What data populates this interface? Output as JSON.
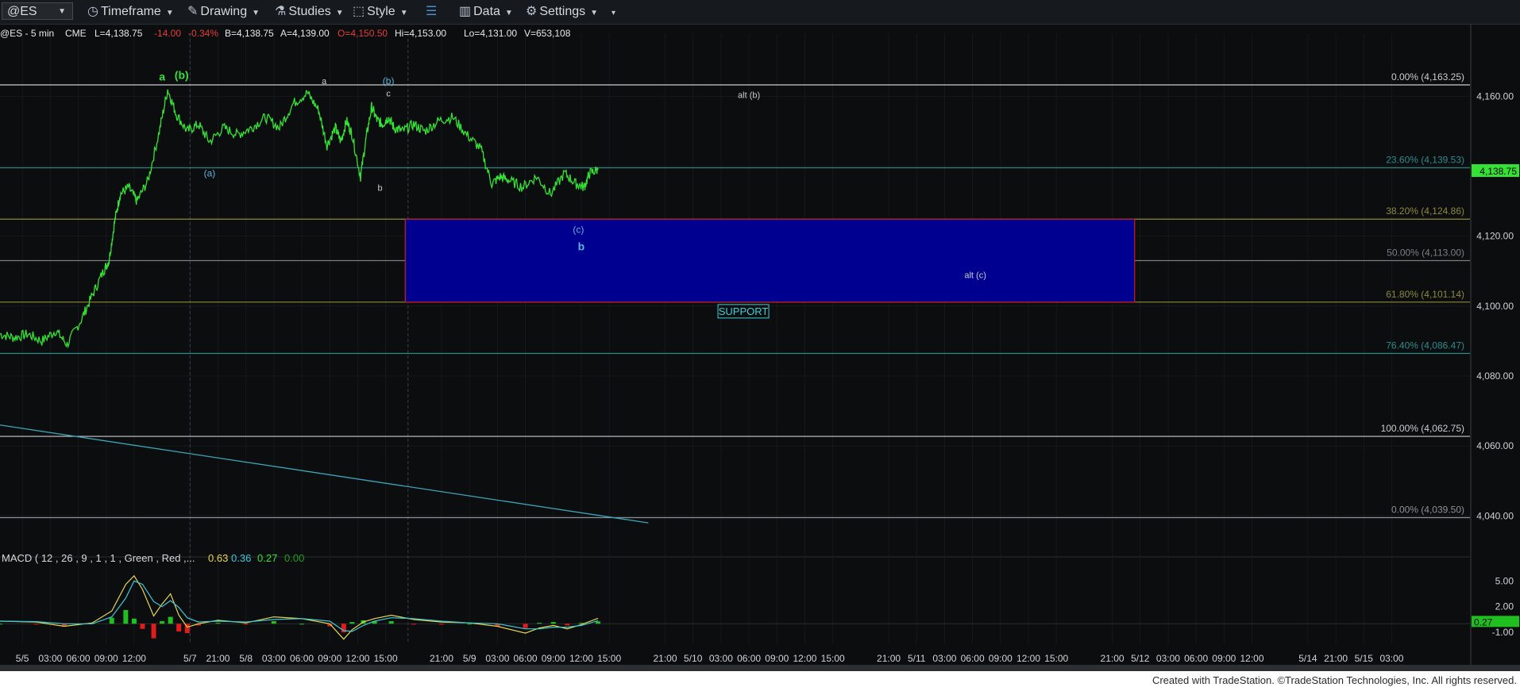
{
  "toolbar": {
    "symbol": "@ES",
    "timeframe": "Timeframe",
    "drawing": "Drawing",
    "studies": "Studies",
    "style": "Style",
    "data": "Data",
    "settings": "Settings"
  },
  "colors": {
    "background": "#0b0d0f",
    "price": "#33e233",
    "support_box": "#000090",
    "support_border": "#c81e1e",
    "axis_text": "#cfd3d8",
    "trendline": "#3aa6b9"
  },
  "chart_data": {
    "type": "line",
    "symbol_line": {
      "symbol": "@ES - 5 min",
      "exchange": "CME",
      "last": "L=4,138.75",
      "change": "-14.00",
      "change_pct": "-0.34%",
      "bid": "B=4,138.75",
      "ask": "A=4,139.00",
      "open": "O=4,150.50",
      "high": "Hi=4,153.00",
      "low": "Lo=4,131.00",
      "volume": "V=653,108"
    },
    "price_axis": {
      "ylim": [
        4031,
        4178
      ],
      "ticks": [
        4160,
        4140,
        4120,
        4100,
        4080,
        4060,
        4040
      ],
      "tick_labels": [
        "4,160.00",
        "4,120.00",
        "4,100.00",
        "4,080.00",
        "4,060.00",
        "4,040.00"
      ],
      "tick_values": [
        4160,
        4120,
        4100,
        4080,
        4060,
        4040
      ],
      "last_price_label": "4,138.75",
      "last_price": 4138.75
    },
    "time_axis": {
      "labels": [
        "5/5",
        "03:00",
        "06:00",
        "09:00",
        "12:00",
        "5/7",
        "21:00",
        "5/8",
        "03:00",
        "06:00",
        "09:00",
        "12:00",
        "15:00",
        "21:00",
        "5/9",
        "03:00",
        "06:00",
        "09:00",
        "12:00",
        "15:00",
        "21:00",
        "5/10",
        "03:00",
        "06:00",
        "09:00",
        "12:00",
        "15:00",
        "21:00",
        "5/11",
        "03:00",
        "06:00",
        "09:00",
        "12:00",
        "15:00",
        "21:00",
        "5/12",
        "03:00",
        "06:00",
        "09:00",
        "12:00",
        "5/14",
        "21:00",
        "5/15",
        "03:00"
      ],
      "positions": [
        0,
        1,
        2,
        3,
        4,
        6,
        7,
        8,
        9,
        10,
        11,
        12,
        13,
        15,
        16,
        17,
        18,
        19,
        20,
        21,
        23,
        24,
        25,
        26,
        27,
        28,
        29,
        31,
        32,
        33,
        34,
        35,
        36,
        37,
        39,
        40,
        41,
        42,
        43,
        44,
        46,
        47,
        48,
        49
      ],
      "xlim": [
        -0.8,
        51.8
      ]
    },
    "price_series": {
      "name": "@ES",
      "x": [
        -0.8,
        -0.3,
        0.2,
        0.7,
        1.2,
        1.6,
        2.1,
        2.5,
        2.9,
        3.1,
        3.3,
        3.5,
        3.8,
        4.1,
        4.5,
        4.9,
        5.2,
        5.5,
        5.9,
        6.3,
        6.7,
        7.2,
        7.7,
        8.2,
        8.7,
        9.2,
        9.7,
        10.2,
        10.6,
        10.9,
        11.2,
        11.4,
        11.6,
        11.8,
        12.1,
        12.3,
        12.5,
        12.7,
        12.9,
        13.1,
        13.3,
        13.6,
        14.0,
        14.4,
        14.9,
        15.4,
        15.9,
        16.4,
        16.8,
        17.1,
        17.4,
        17.9,
        18.4,
        18.9,
        19.4,
        19.8,
        20.1,
        20.3,
        20.6
      ],
      "y": [
        4092,
        4091,
        4092,
        4090,
        4093,
        4089,
        4096,
        4103,
        4110,
        4113,
        4124,
        4132,
        4134,
        4130,
        4136,
        4150,
        4162,
        4155,
        4150,
        4152,
        4147,
        4151,
        4149,
        4151,
        4154,
        4151,
        4158,
        4161,
        4156,
        4146,
        4151,
        4147,
        4153,
        4149,
        4137,
        4148,
        4157,
        4153,
        4152,
        4154,
        4151,
        4150,
        4152,
        4150,
        4153,
        4154,
        4149,
        4145,
        4135,
        4137,
        4136,
        4134,
        4137,
        4132,
        4138,
        4135,
        4134,
        4138,
        4139
      ]
    },
    "fib_levels": [
      {
        "label": "0.00% (4,163.25)",
        "value": 4163.25,
        "color": "#c9ccd1"
      },
      {
        "label": "23.60% (4,139.53)",
        "value": 4139.53,
        "color": "#2a8c8c"
      },
      {
        "label": "38.20% (4,124.86)",
        "value": 4124.86,
        "color": "#8f8a3a"
      },
      {
        "label": "50.00% (4,113.00)",
        "value": 4113.0,
        "color": "#7a7e84"
      },
      {
        "label": "61.80% (4,101.14)",
        "value": 4101.14,
        "color": "#8f8a3a"
      },
      {
        "label": "76.40% (4,086.47)",
        "value": 4086.47,
        "color": "#2a8c8c"
      },
      {
        "label": "100.00% (4,062.75)",
        "value": 4062.75,
        "color": "#c9ccd1"
      },
      {
        "label": "0.00% (4,039.50)",
        "value": 4039.5,
        "color": "#8d9096"
      }
    ],
    "support_zone": {
      "x_start": 13.7,
      "x_end": 39.8,
      "y_top": 4124.86,
      "y_bottom": 4101.14
    },
    "support_label": "SUPPORT",
    "trendline": {
      "x": [
        -0.8,
        22.4
      ],
      "y": [
        4066,
        4038
      ]
    },
    "wave_labels": [
      {
        "text": "a",
        "x": 5.0,
        "y": 4164.5,
        "color": "#33e233",
        "size": 14
      },
      {
        "text": "(b)",
        "x": 5.7,
        "y": 4165.0,
        "color": "#33e233",
        "size": 14
      },
      {
        "text": "(a)",
        "x": 6.7,
        "y": 4137.0,
        "color": "#5ab4d8",
        "size": 12
      },
      {
        "text": "a",
        "x": 10.8,
        "y": 4163.5,
        "color": "#c9ccd1",
        "size": 11
      },
      {
        "text": "b",
        "x": 12.8,
        "y": 4133.0,
        "color": "#c9ccd1",
        "size": 11
      },
      {
        "text": "(b)",
        "x": 13.1,
        "y": 4163.5,
        "color": "#5ab4d8",
        "size": 12
      },
      {
        "text": "c",
        "x": 13.1,
        "y": 4160.0,
        "color": "#c9ccd1",
        "size": 11
      },
      {
        "text": "alt (b)",
        "x": 26.0,
        "y": 4159.5,
        "color": "#c9ccd1",
        "size": 11
      },
      {
        "text": "(c)",
        "x": 19.9,
        "y": 4121.0,
        "color": "#5ab4d8",
        "size": 12
      },
      {
        "text": "b",
        "x": 20.0,
        "y": 4116.0,
        "color": "#5ab4d8",
        "size": 14
      },
      {
        "text": "alt (c)",
        "x": 34.1,
        "y": 4108.0,
        "color": "#c9ccd1",
        "size": 11
      }
    ],
    "session_dividers_x": [
      6.0,
      13.8
    ],
    "macd": {
      "title": "MACD ( 12 , 26 , 9 , 1 , 1 , Green , Red ,...",
      "values_text": [
        "0.63",
        "0.36",
        "0.27",
        "0.00"
      ],
      "value_colors": [
        "#e8d64a",
        "#3ac8d8",
        "#33e233",
        "#1e9c1e"
      ],
      "ylim": [
        -2.2,
        6.6
      ],
      "ticks": [
        5,
        2,
        -1
      ],
      "tick_labels": [
        "5.00",
        "2.00",
        "-1.00"
      ],
      "last_label": "0.27",
      "last_value": 0.27,
      "x": [
        -0.8,
        0.5,
        1.5,
        2.5,
        3.2,
        3.7,
        4.0,
        4.3,
        4.7,
        5.0,
        5.3,
        5.6,
        5.9,
        6.3,
        7.0,
        8.0,
        9.0,
        10.0,
        11.0,
        11.5,
        11.8,
        12.2,
        12.6,
        13.2,
        14.0,
        15.0,
        16.0,
        17.0,
        18.0,
        18.5,
        19.0,
        19.5,
        20.0,
        20.6
      ],
      "macd_line": [
        0.3,
        0.2,
        -0.3,
        0.1,
        1.5,
        4.6,
        5.6,
        4.0,
        0.9,
        2.3,
        3.5,
        1.0,
        -0.4,
        0.0,
        0.4,
        0.1,
        0.8,
        0.6,
        0.0,
        -1.8,
        -0.7,
        0.2,
        0.6,
        1.0,
        0.5,
        0.2,
        0.1,
        -0.3,
        -1.1,
        -0.5,
        -0.2,
        -0.6,
        -0.1,
        0.63
      ],
      "signal_line": [
        0.3,
        0.25,
        0.0,
        0.0,
        0.8,
        3.0,
        5.0,
        4.6,
        2.6,
        2.0,
        2.7,
        1.9,
        0.7,
        0.2,
        0.3,
        0.2,
        0.5,
        0.6,
        0.3,
        -0.8,
        -0.9,
        -0.2,
        0.3,
        0.7,
        0.6,
        0.3,
        0.1,
        0.0,
        -0.6,
        -0.6,
        -0.4,
        -0.4,
        -0.2,
        0.36
      ],
      "hist": [
        0.0,
        -0.05,
        -0.3,
        0.1,
        0.7,
        1.6,
        0.6,
        -0.6,
        -1.7,
        0.3,
        0.8,
        -0.9,
        -1.1,
        -0.2,
        0.1,
        -0.1,
        0.3,
        0.0,
        -0.3,
        -1.0,
        0.2,
        0.4,
        0.3,
        0.3,
        -0.1,
        -0.1,
        0.0,
        -0.3,
        -0.5,
        0.1,
        0.2,
        -0.2,
        0.1,
        0.27
      ]
    },
    "footer": "Created with TradeStation. ©TradeStation Technologies, Inc. All rights reserved."
  }
}
